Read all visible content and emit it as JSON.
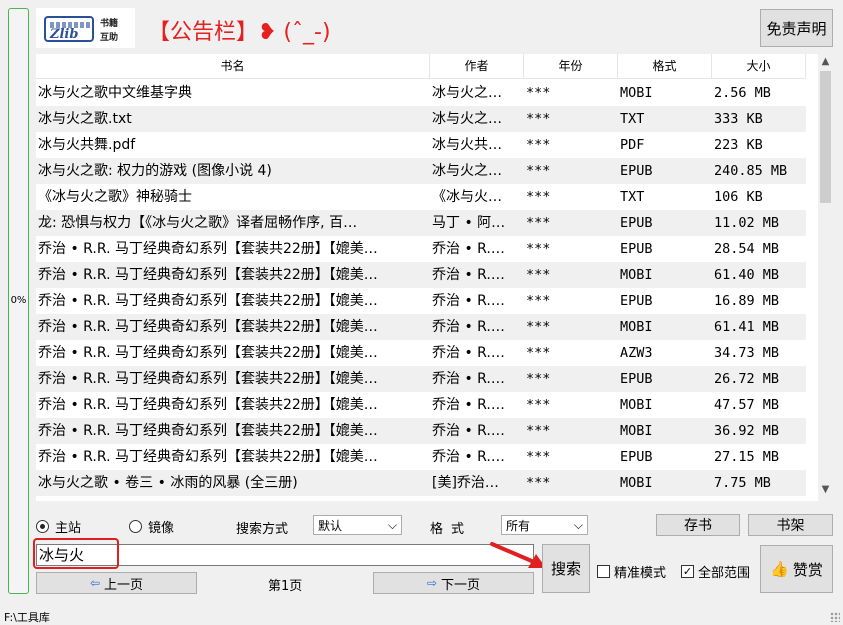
{
  "progress": {
    "value": 0,
    "text": "0%"
  },
  "logo": {
    "brand": "Zlib",
    "line1": "书籍",
    "line2": "互助"
  },
  "banner": "【公告栏】❥ (ˆ_-)",
  "buttons": {
    "disclaimer": "免责声明",
    "save": "存书",
    "shelf": "书架",
    "search": "搜索",
    "prev": "上一页",
    "next": "下一页",
    "donate": "赞赏"
  },
  "table": {
    "headers": [
      "书名",
      "作者",
      "年份",
      "格式",
      "大小"
    ],
    "rows": [
      [
        "冰与火之歌中文维基字典",
        "冰与火之…",
        "***",
        "MOBI",
        "2.56 MB"
      ],
      [
        "冰与火之歌.txt",
        "冰与火之…",
        "***",
        "TXT",
        "333 KB"
      ],
      [
        "冰与火共舞.pdf",
        "冰与火共…",
        "***",
        "PDF",
        "223 KB"
      ],
      [
        "冰与火之歌: 权力的游戏 (图像小说 4)",
        "冰与火之…",
        "***",
        "EPUB",
        "240.85 MB"
      ],
      [
        "《冰与火之歌》神秘骑士",
        "《冰与火…",
        "***",
        "TXT",
        "106 KB"
      ],
      [
        "龙: 恐惧与权力【《冰与火之歌》译者屈畅作序, 百…",
        "马丁 • 阿…",
        "***",
        "EPUB",
        "11.02 MB"
      ],
      [
        "乔治 • R.R. 马丁经典奇幻系列【套装共22册】【媲美…",
        "乔治 • R.…",
        "***",
        "EPUB",
        "28.54 MB"
      ],
      [
        "乔治 • R.R. 马丁经典奇幻系列【套装共22册】【媲美…",
        "乔治 • R.…",
        "***",
        "MOBI",
        "61.40 MB"
      ],
      [
        "乔治 • R.R. 马丁经典奇幻系列【套装共22册】【媲美…",
        "乔治 • R.…",
        "***",
        "EPUB",
        "16.89 MB"
      ],
      [
        "乔治 • R.R. 马丁经典奇幻系列【套装共22册】【媲美…",
        "乔治 • R.…",
        "***",
        "MOBI",
        "61.41 MB"
      ],
      [
        "乔治 • R.R. 马丁经典奇幻系列【套装共22册】【媲美…",
        "乔治 • R.…",
        "***",
        "AZW3",
        "34.73 MB"
      ],
      [
        "乔治 • R.R. 马丁经典奇幻系列【套装共22册】【媲美…",
        "乔治 • R.…",
        "***",
        "EPUB",
        "26.72 MB"
      ],
      [
        "乔治 • R.R. 马丁经典奇幻系列【套装共22册】【媲美…",
        "乔治 • R.…",
        "***",
        "MOBI",
        "47.57 MB"
      ],
      [
        "乔治 • R.R. 马丁经典奇幻系列【套装共22册】【媲美…",
        "乔治 • R.…",
        "***",
        "MOBI",
        "36.92 MB"
      ],
      [
        "乔治 • R.R. 马丁经典奇幻系列【套装共22册】【媲美…",
        "乔治 • R.…",
        "***",
        "EPUB",
        "27.15 MB"
      ],
      [
        "冰与火之歌 • 卷三 • 冰雨的风暴 (全三册)",
        "[美]乔治…",
        "***",
        "MOBI",
        "7.75 MB"
      ]
    ]
  },
  "source": {
    "main": "主站",
    "mirror": "镜像",
    "selected": "main"
  },
  "search_mode": {
    "label": "搜索方式",
    "value": "默认"
  },
  "format_filter": {
    "label": "格式",
    "value": "所有"
  },
  "search": {
    "query": "冰与火"
  },
  "page": {
    "label": "第1页"
  },
  "options": {
    "precise": "精准模式",
    "precise_checked": false,
    "all_scope": "全部范围",
    "all_scope_checked": true
  },
  "status": {
    "path": "F:\\工具库"
  },
  "colors": {
    "banner": "#e62020",
    "progress": "#4fb24f",
    "highlight": "#e02020",
    "arrow_icon": "#2b6fd6"
  }
}
